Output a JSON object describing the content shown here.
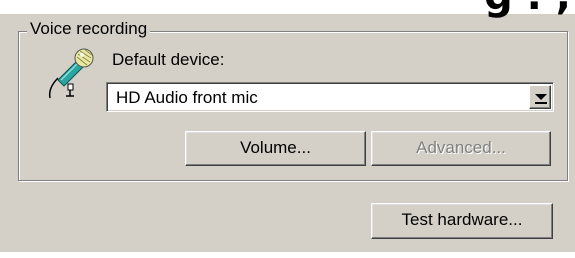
{
  "header": {
    "clipped_heading": "g . ,"
  },
  "voice_recording": {
    "group_label": "Voice recording",
    "default_device_label": "Default device:",
    "device_value": "HD Audio front mic",
    "volume_button": "Volume...",
    "advanced_button": "Advanced...",
    "advanced_enabled": false
  },
  "footer": {
    "test_hardware_button": "Test hardware..."
  },
  "icons": {
    "microphone": "microphone-icon",
    "dropdown": "chevron-down-icon"
  },
  "colors": {
    "dialog_background": "#d4d0c8",
    "disabled_text": "#808080",
    "mic_teal": "#2aa5a0"
  }
}
